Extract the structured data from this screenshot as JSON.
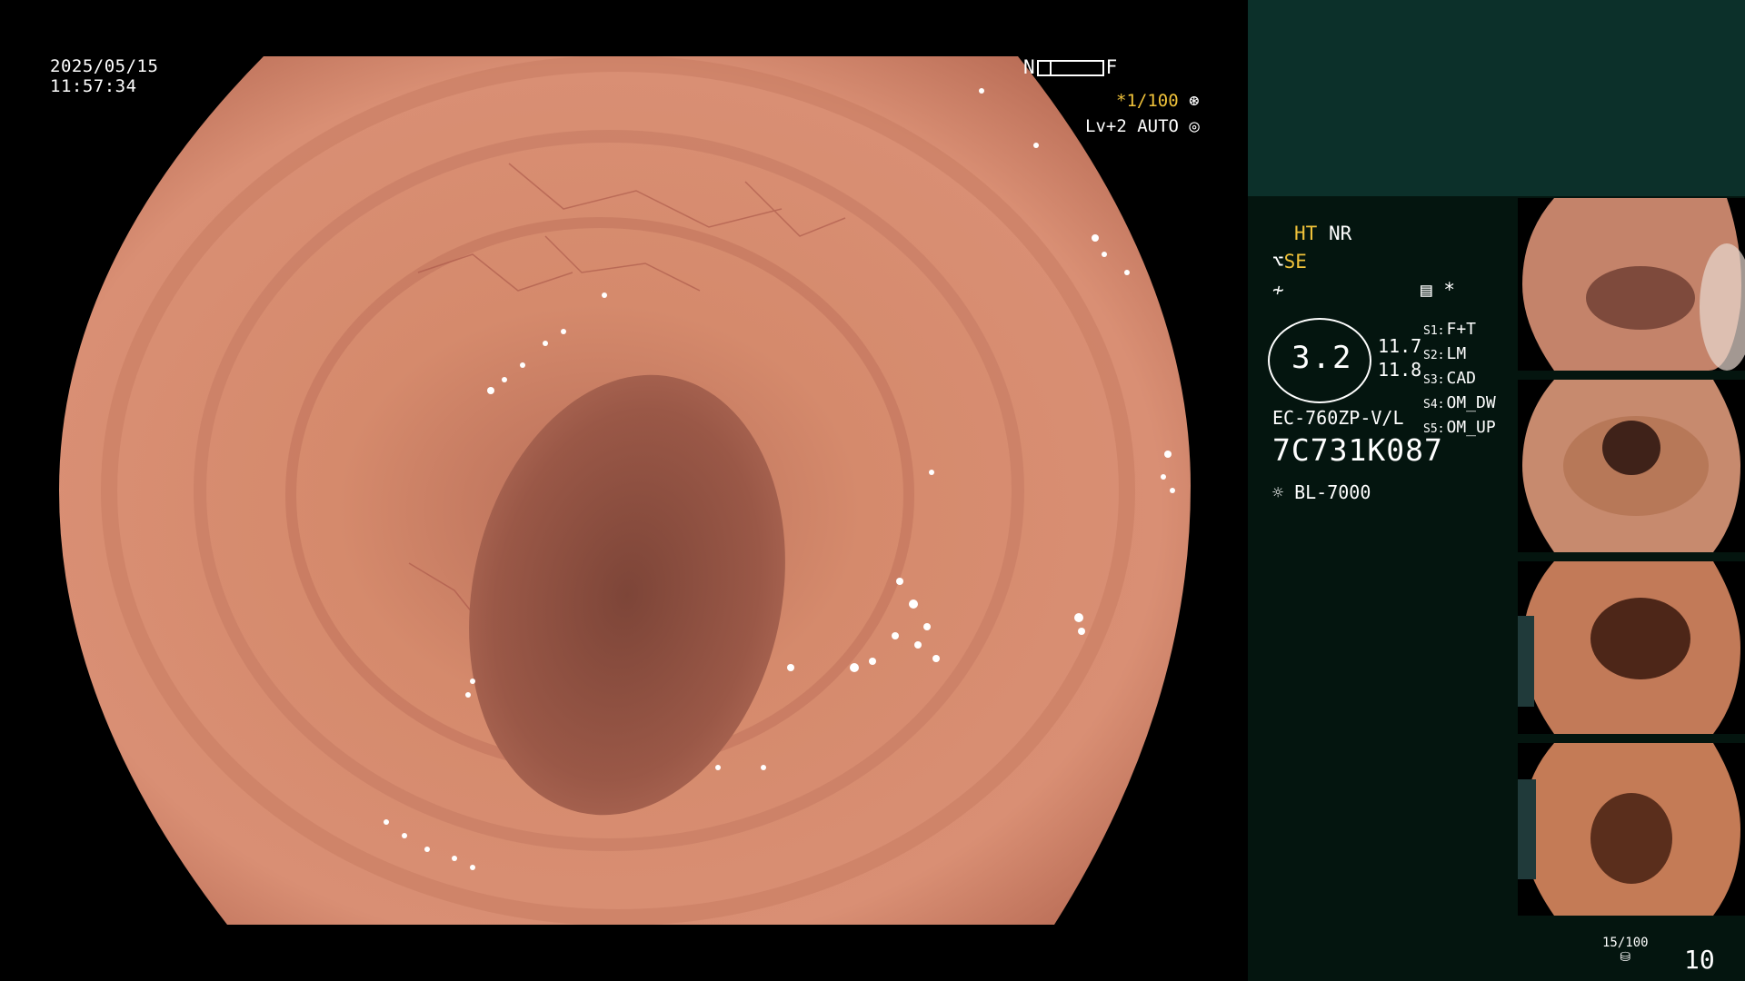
{
  "main": {
    "date": "2025/05/15",
    "time": "11:57:34",
    "nf_near": "N",
    "nf_far": "F",
    "shutter": "*1/100",
    "light_mode": "Lv+2 AUTO"
  },
  "panel": {
    "ht": "HT",
    "nr": "NR",
    "se": "SE",
    "memo_mark": "*",
    "scope_number": "3.2",
    "scope_val_1": "11.7",
    "scope_val_2": "11.8",
    "switches": [
      {
        "key": "S1:",
        "value": "F+T"
      },
      {
        "key": "S2:",
        "value": "LM"
      },
      {
        "key": "S3:",
        "value": "CAD"
      },
      {
        "key": "S4:",
        "value": "OM_DW"
      },
      {
        "key": "S5:",
        "value": "OM_UP"
      }
    ],
    "scope_model": "EC-760ZP-V/L",
    "scope_serial": "7C731K087",
    "light_source": "BL-7000",
    "capture_count": "15/100",
    "capture_total": "10"
  },
  "colors": {
    "panel_bg": "#04150f",
    "panel_top_bg": "#0c302a",
    "osd_yellow": "#f0c23a",
    "mucosa": "#c97a5e"
  }
}
